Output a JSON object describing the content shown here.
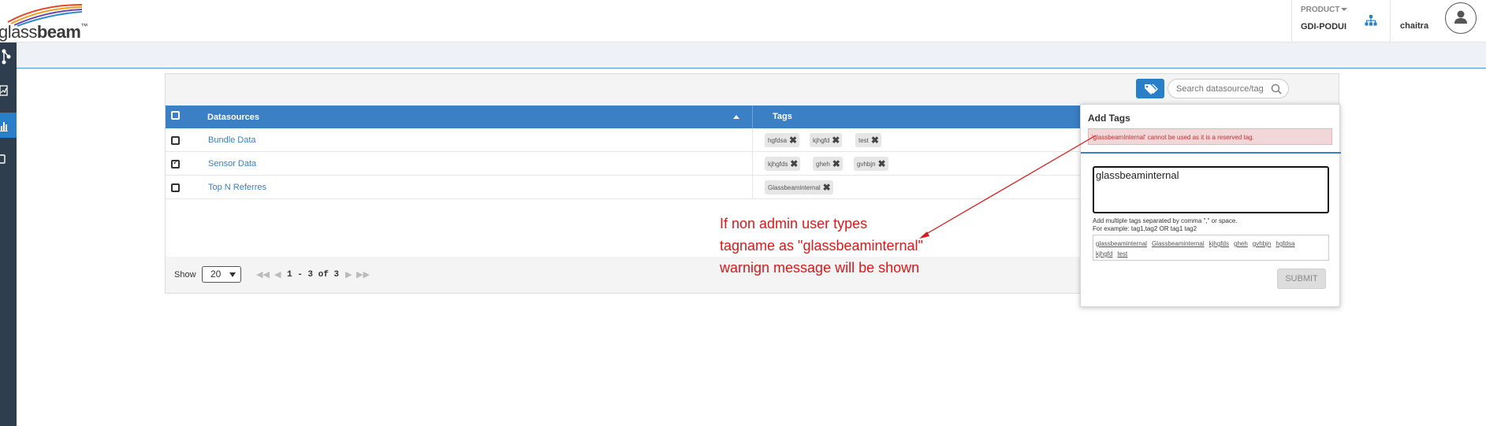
{
  "header": {
    "logo": {
      "prefix": "glass",
      "bold": "beam",
      "tm": "™"
    },
    "product_label": "PRODUCT",
    "product_name": "GDI-PODUI",
    "username": "chaitra"
  },
  "toolbar": {
    "search_placeholder": "Search datasource/tag"
  },
  "table": {
    "columns": [
      "Datasources",
      "Tags"
    ],
    "rows": [
      {
        "name": "Bundle Data",
        "checked": false,
        "tags": [
          "hgfdsa",
          "kjhgfd",
          "test"
        ]
      },
      {
        "name": "Sensor Data",
        "checked": true,
        "tags": [
          "kjhgfds",
          "gheh",
          "gvhbjn"
        ]
      },
      {
        "name": "Top N Referres",
        "checked": false,
        "tags": [
          "Glassbeaminternal"
        ]
      }
    ]
  },
  "pager": {
    "show_label": "Show",
    "page_size": "20",
    "range_text": "1 - 3 of 3"
  },
  "popup": {
    "title": "Add Tags",
    "error": "'glassbeamInternal' cannot be used as it is a reserved tag.",
    "input_value": "glassbeaminternal",
    "hint_line1": "Add multiple tags separated by comma \",\" or space.",
    "hint_line2": "For example: tag1,tag2 OR tag1 tag2",
    "suggestions": [
      "glassbeaminternal",
      "Glassbeaminternal",
      "kjhgfds",
      "gheh",
      "gvhbjn",
      "hgfdsa",
      "kjhgfd",
      "test"
    ],
    "submit_label": "SUBMIT"
  },
  "annotation": {
    "line1": "If non admin user types",
    "line2": "tagname as \"glassbeaminternal\"",
    "line3": "warnign message will be shown"
  },
  "colors": {
    "primary": "#3b7fc4",
    "sidebar": "#2e3e4e",
    "annotation": "#d9191c",
    "error_bg": "#f2d7d9"
  }
}
